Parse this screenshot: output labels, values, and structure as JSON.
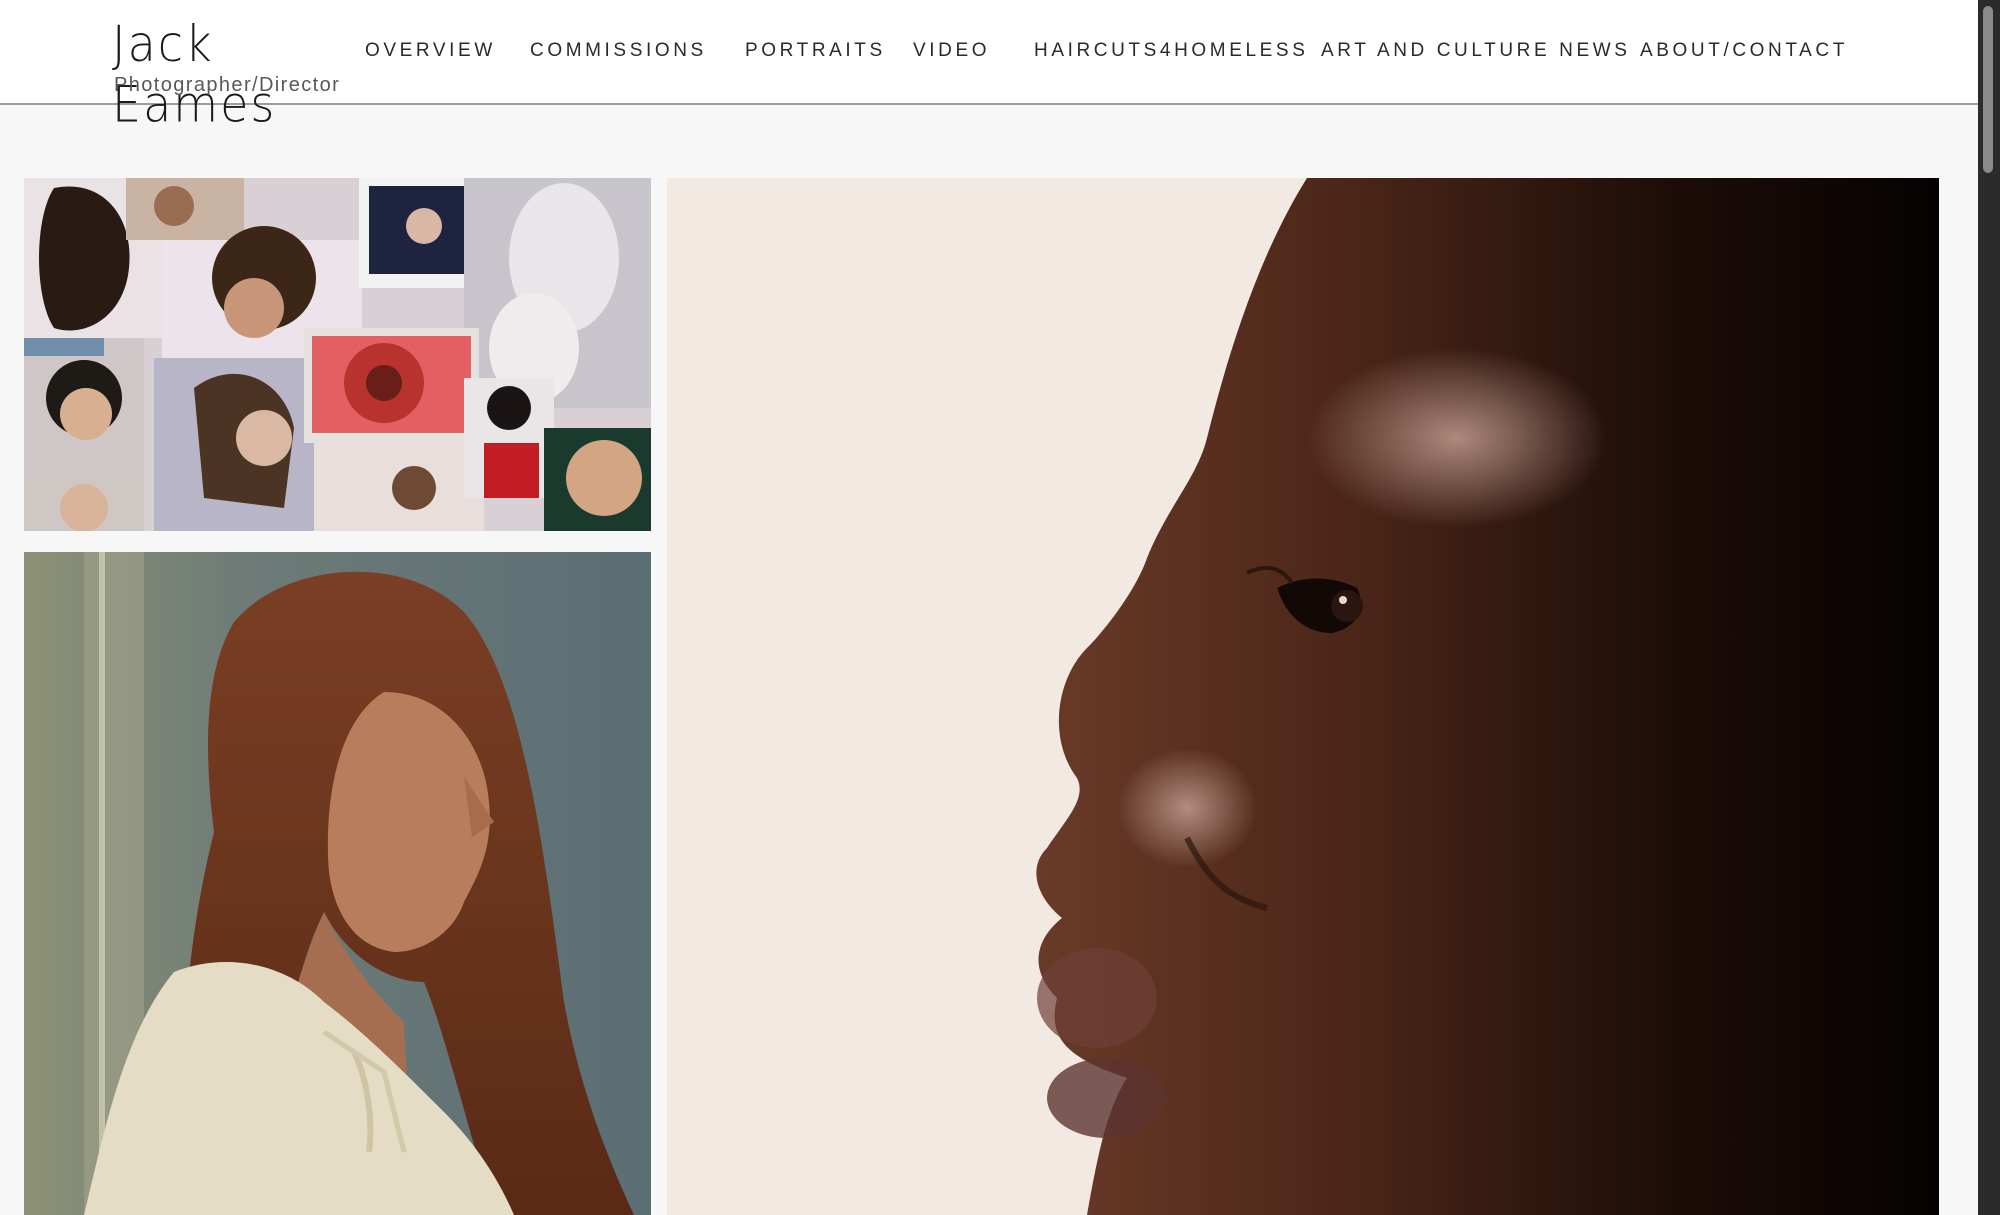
{
  "brand": {
    "name": "Jack Eames",
    "tagline": "Photographer/Director"
  },
  "nav": {
    "items": [
      {
        "label": "OVERVIEW"
      },
      {
        "label": "COMMISSIONS"
      },
      {
        "label": "PORTRAITS"
      },
      {
        "label": "VIDEO"
      },
      {
        "label": "HAIRCUTS4HOMELESS"
      },
      {
        "label": "ART AND CULTURE NEWS"
      },
      {
        "label": "ABOUT/CONTACT"
      }
    ]
  },
  "gallery": {
    "tiles": [
      {
        "name": "collage-tile"
      },
      {
        "name": "long-hair-portrait-tile"
      },
      {
        "name": "profile-portrait-tile"
      }
    ]
  },
  "colors": {
    "header_bg": "#ffffff",
    "page_bg": "#f7f7f8",
    "header_rule": "#9c9c9c",
    "nav_text": "#2a2a2a",
    "scrollbar": "#2b2b2b"
  }
}
